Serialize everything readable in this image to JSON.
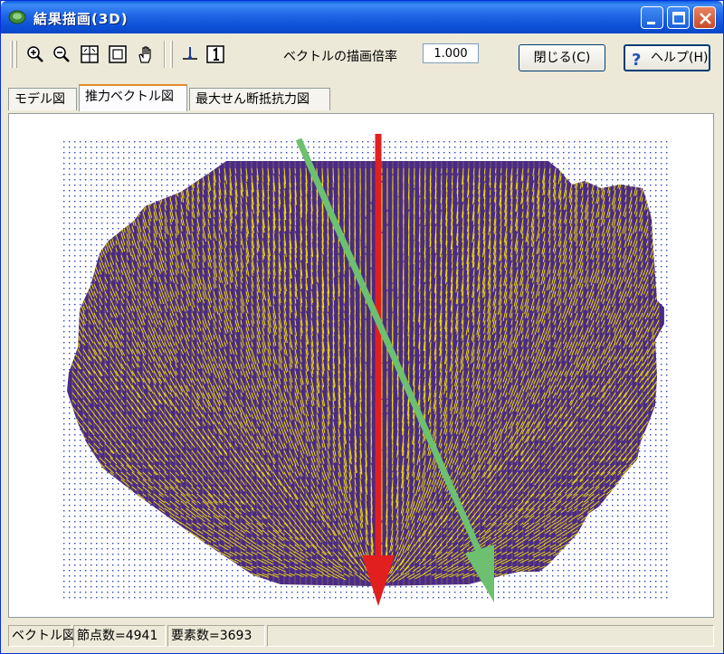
{
  "window": {
    "title": "結果描画(3D)"
  },
  "toolbar": {
    "tools": [
      {
        "name": "zoom-in-icon"
      },
      {
        "name": "zoom-out-icon"
      },
      {
        "name": "fit-grid-icon"
      },
      {
        "name": "window-zoom-icon"
      },
      {
        "name": "pan-hand-icon"
      },
      {
        "name": "node-select-icon"
      },
      {
        "name": "number-one-icon"
      }
    ],
    "scale_label": "ベクトルの描画倍率",
    "scale_value": "1.000",
    "close_label": "閉じる(C)",
    "help_label": "ヘルプ(H)"
  },
  "tabs": [
    {
      "label": "モデル図",
      "active": false
    },
    {
      "label": "推力ベクトル図",
      "active": true
    },
    {
      "label": "最大せん断抵抗力図",
      "active": false
    }
  ],
  "status": {
    "view": "ベクトル図",
    "nodes": "節点数=4941",
    "elements": "要素数=3693"
  },
  "colors": {
    "mesh_fill": "#4a2a86",
    "vector": "#f5e400",
    "grid_dot": "#2a3fc8",
    "arrow_red": "#e11f1f",
    "arrow_green": "#6cc070"
  }
}
